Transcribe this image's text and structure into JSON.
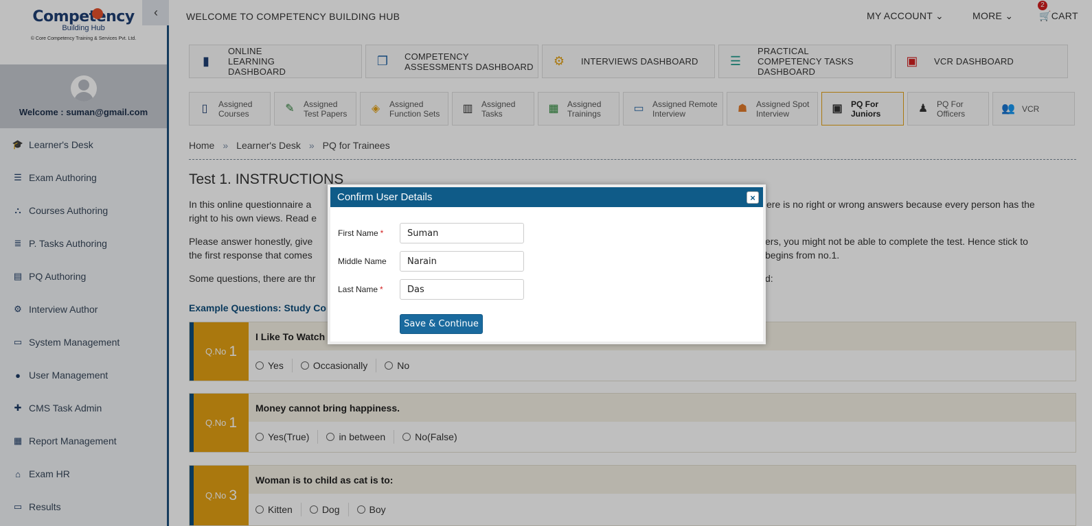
{
  "brand": {
    "name": "Competency",
    "sub": "Building Hub",
    "tagline": "© Core Competency Training & Services Pvt. Ltd."
  },
  "user": {
    "welcome": "Welcome : suman@gmail.com"
  },
  "sidebar": {
    "items": [
      {
        "label": "Learner's Desk",
        "icon": "graduation-cap-icon"
      },
      {
        "label": "Exam Authoring",
        "icon": "list-icon"
      },
      {
        "label": "Courses Authoring",
        "icon": "sitemap-icon"
      },
      {
        "label": "P. Tasks Authoring",
        "icon": "tasks-icon"
      },
      {
        "label": "PQ Authoring",
        "icon": "book-icon"
      },
      {
        "label": "Interview Author",
        "icon": "cogs-icon"
      },
      {
        "label": "System Management",
        "icon": "desktop-icon"
      },
      {
        "label": "User Management",
        "icon": "user-icon"
      },
      {
        "label": "CMS Task Admin",
        "icon": "user-plus-icon"
      },
      {
        "label": "Report Management",
        "icon": "report-icon"
      },
      {
        "label": "Exam HR",
        "icon": "bank-icon"
      },
      {
        "label": "Results",
        "icon": "desktop-icon"
      }
    ]
  },
  "header": {
    "title": "WELCOME TO COMPETENCY BUILDING HUB",
    "my_account": "MY ACCOUNT",
    "more": "MORE",
    "cart": "CART",
    "cart_count": "2"
  },
  "dashboards": [
    {
      "label": "ONLINE LEARNING DASHBOARD",
      "icon": "book-icon"
    },
    {
      "label": "COMPETENCY ASSESSMENTS DASHBOARD",
      "icon": "documents-icon"
    },
    {
      "label": "INTERVIEWS DASHBOARD",
      "icon": "gears-icon"
    },
    {
      "label": "PRACTICAL COMPETENCY TASKS DASHBOARD",
      "icon": "tasks-icon"
    },
    {
      "label": "VCR DASHBOARD",
      "icon": "video-file-icon"
    }
  ],
  "subnav": [
    {
      "label": "Assigned Courses",
      "icon": "document-icon"
    },
    {
      "label": "Assigned Test Papers",
      "icon": "test-paper-icon"
    },
    {
      "label": "Assigned Function Sets",
      "icon": "function-icon"
    },
    {
      "label": "Assigned Tasks",
      "icon": "clipboard-icon"
    },
    {
      "label": "Assigned Trainings",
      "icon": "training-icon"
    },
    {
      "label": "Assigned Remote Interview",
      "icon": "remote-icon"
    },
    {
      "label": "Assigned Spot Interview",
      "icon": "meeting-icon"
    },
    {
      "label": "PQ For Juniors",
      "icon": "presentation-icon"
    },
    {
      "label": "PQ For Officers",
      "icon": "officer-icon"
    },
    {
      "label": "VCR",
      "icon": "users-icon"
    }
  ],
  "breadcrumb": [
    "Home",
    "Learner's Desk",
    "PQ for Trainees"
  ],
  "content": {
    "title": "Test 1. INSTRUCTIONS",
    "p1_a": "In this online questionnaire a",
    "p1_b": "ere is no right or wrong answers because every person has the",
    "p1_c": "right to his own views. Read e",
    "p2_a": "Please answer honestly, give",
    "p2_b": "ers, you might not be able to complete the test. Hence stick to",
    "p2_c": "the first response that comes",
    "p2_d": "begins from no.1.",
    "p3_a": "Some questions, there are thr",
    "p3_b": "d:",
    "example": "Example Questions: Study Co"
  },
  "questions": [
    {
      "prefix": "Q.No",
      "num": "1",
      "text": "I Like To Watch T",
      "options": [
        "Yes",
        "Occasionally",
        "No"
      ]
    },
    {
      "prefix": "Q.No",
      "num": "1",
      "text": "Money cannot bring happiness.",
      "options": [
        "Yes(True)",
        "in between",
        "No(False)"
      ]
    },
    {
      "prefix": "Q.No",
      "num": "3",
      "text": "Woman is to child as cat is to:",
      "options": [
        "Kitten",
        "Dog",
        "Boy"
      ]
    }
  ],
  "modal": {
    "title": "Confirm User Details",
    "first_label": "First Name",
    "first_value": "Suman",
    "middle_label": "Middle Name",
    "middle_value": "Narain",
    "last_label": "Last Name",
    "last_value": "Das",
    "required_mark": "*",
    "save": "Save & Continue",
    "close": "×"
  }
}
